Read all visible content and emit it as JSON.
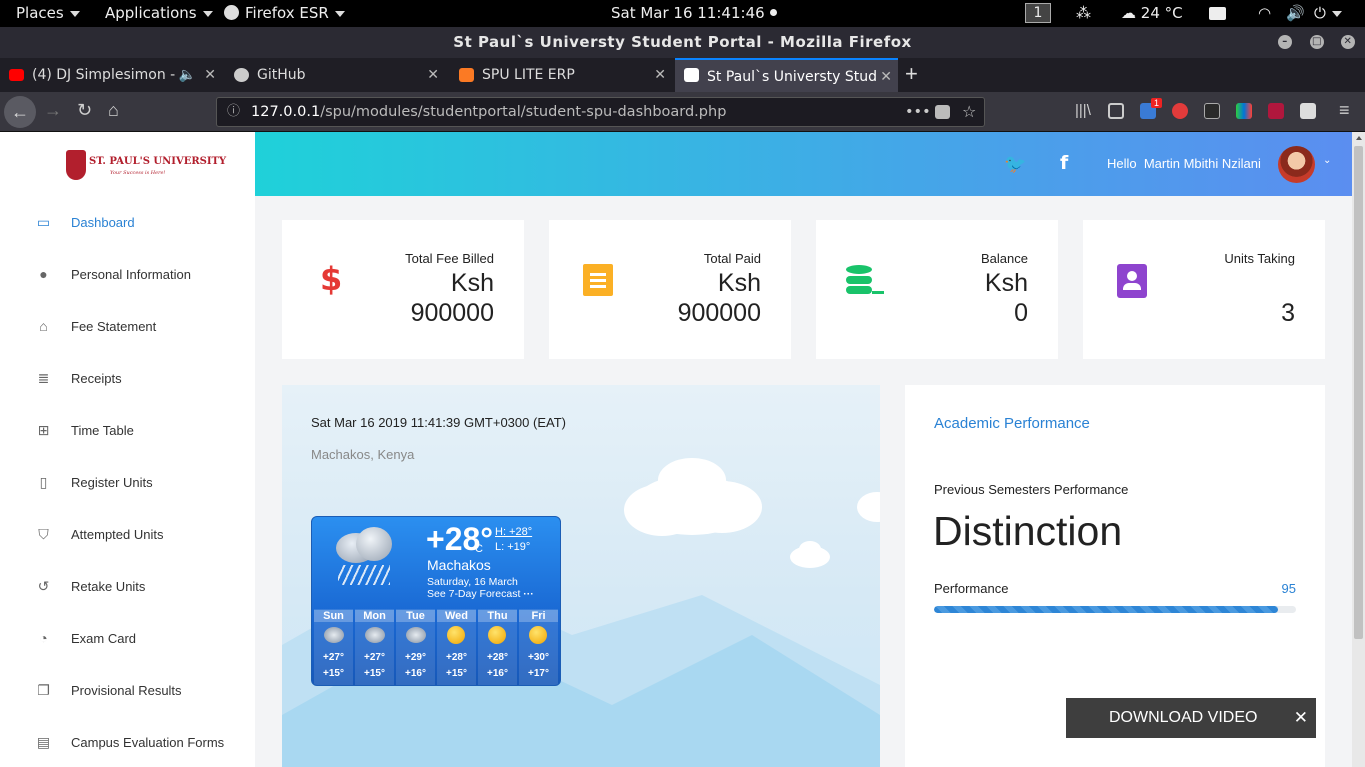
{
  "topbar": {
    "places": "Places",
    "applications": "Applications",
    "browser": "Firefox ESR",
    "clock": "Sat Mar 16  11:41:46",
    "workspace": "1",
    "weather": "24 °C"
  },
  "window": {
    "title": "St Paul`s Universty Student Portal - Mozilla Firefox"
  },
  "tabs": [
    {
      "label": "(4) DJ Simplesimon -",
      "icon": "youtube-icon"
    },
    {
      "label": "GitHub",
      "icon": "github-icon"
    },
    {
      "label": "SPU LITE ERP",
      "icon": "xampp-icon"
    },
    {
      "label": "St Paul`s Universty Stud",
      "icon": "spu-icon"
    }
  ],
  "navbar": {
    "url_host": "127.0.0.1",
    "url_path": "/spu/modules/studentportal/student-spu-dashboard.php",
    "badge": "1"
  },
  "sidebar": {
    "logo_text": "ST. PAUL'S UNIVERSITY",
    "logo_motto": "Your Success is Here!",
    "items": [
      {
        "label": "Dashboard",
        "icon": "monitor-icon"
      },
      {
        "label": "Personal Information",
        "icon": "person-icon"
      },
      {
        "label": "Fee Statement",
        "icon": "bank-icon"
      },
      {
        "label": "Receipts",
        "icon": "receipt-icon"
      },
      {
        "label": "Time Table",
        "icon": "table-icon"
      },
      {
        "label": "Register Units",
        "icon": "clipboard-icon"
      },
      {
        "label": "Attempted Units",
        "icon": "shield-check-icon"
      },
      {
        "label": "Retake Units",
        "icon": "history-icon"
      },
      {
        "label": "Exam Card",
        "icon": "palette-icon"
      },
      {
        "label": "Provisional Results",
        "icon": "copy-icon"
      },
      {
        "label": "Campus Evaluation Forms",
        "icon": "library-icon"
      }
    ]
  },
  "header": {
    "greeting": "Hello  Martin Mbithi Nzilani"
  },
  "cards": [
    {
      "label": "Total Fee Billed",
      "currency": "Ksh",
      "value": "900000",
      "icon": "dollar-icon",
      "color": "#e53935"
    },
    {
      "label": "Total Paid",
      "currency": "Ksh",
      "value": "900000",
      "icon": "receipt-icon",
      "color": "#fbb025"
    },
    {
      "label": "Balance",
      "currency": "Ksh",
      "value": "0",
      "icon": "database-minus-icon",
      "color": "#19c36a"
    },
    {
      "label": "Units Taking",
      "currency": "",
      "value": "3",
      "icon": "account-box-icon",
      "color": "#8e44ce"
    }
  ],
  "weather": {
    "datetime": "Sat Mar 16 2019 11:41:39 GMT+0300 (EAT)",
    "location": "Machakos, Kenya",
    "temp": "+28°",
    "unit": "C",
    "high": "H: +28°",
    "low": "L: +19°",
    "city": "Machakos",
    "date": "Saturday, 16 March",
    "forecast_link": "See 7-Day Forecast",
    "days": [
      {
        "day": "Sun",
        "hi": "+27°",
        "lo": "+15°",
        "icon": "rain-icon"
      },
      {
        "day": "Mon",
        "hi": "+27°",
        "lo": "+15°",
        "icon": "rain-icon"
      },
      {
        "day": "Tue",
        "hi": "+29°",
        "lo": "+16°",
        "icon": "rain-icon"
      },
      {
        "day": "Wed",
        "hi": "+28°",
        "lo": "+15°",
        "icon": "sun-icon"
      },
      {
        "day": "Thu",
        "hi": "+28°",
        "lo": "+16°",
        "icon": "sun-icon"
      },
      {
        "day": "Fri",
        "hi": "+30°",
        "lo": "+17°",
        "icon": "sun-icon"
      }
    ]
  },
  "performance": {
    "title": "Academic Performance",
    "subtitle": "Previous Semesters Performance",
    "grade": "Distinction",
    "label": "Performance",
    "value": "95",
    "progress": 0.95
  },
  "download": {
    "label": "DOWNLOAD VIDEO"
  }
}
